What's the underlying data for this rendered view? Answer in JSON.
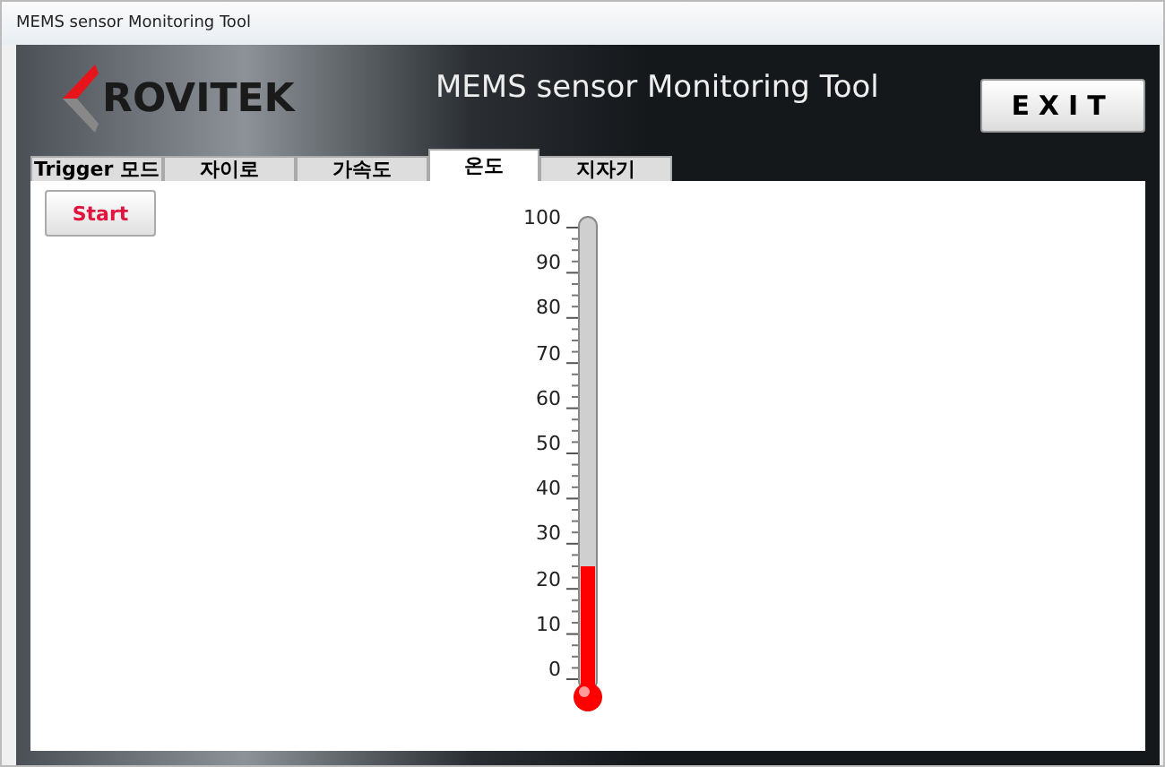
{
  "window": {
    "title": "MEMS sensor Monitoring Tool"
  },
  "header": {
    "logo": "ROVITEK",
    "title": "MEMS sensor Monitoring Tool",
    "exit_button": "EXIT"
  },
  "tabs": [
    {
      "label": "Trigger 모드",
      "selected": false
    },
    {
      "label": "자이로",
      "selected": false
    },
    {
      "label": "가속도",
      "selected": false
    },
    {
      "label": "온도",
      "selected": true
    },
    {
      "label": "지자기",
      "selected": false
    }
  ],
  "start_button": "Start",
  "thermometer": {
    "level": 0.25,
    "scale": [
      "100",
      "90",
      "80",
      "70",
      "60",
      "50",
      "40",
      "30",
      "20",
      "10",
      "0"
    ]
  }
}
